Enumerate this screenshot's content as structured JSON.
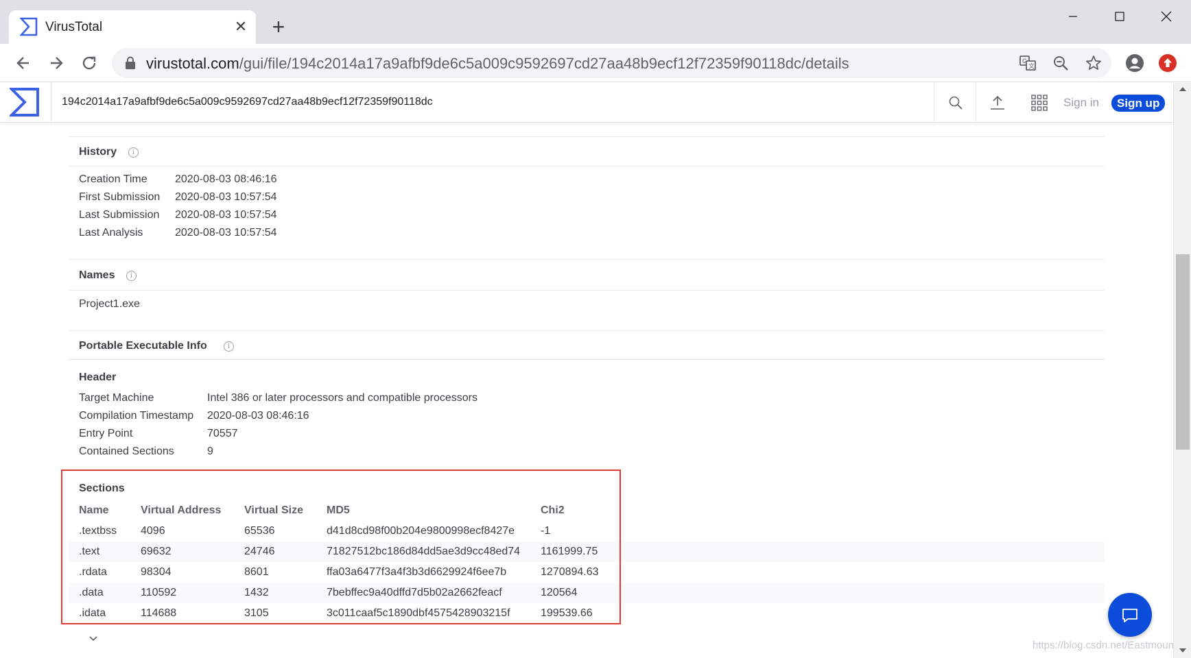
{
  "browser": {
    "tab_title": "VirusTotal",
    "tab_close": "✕",
    "new_tab": "+",
    "url_host": "virustotal.com",
    "url_path": "/gui/file/194c2014a17a9afbf9de6c5a009c9592697cd27aa48b9ecf12f72359f90118dc/details"
  },
  "header": {
    "search_value": "194c2014a17a9afbf9de6c5a009c9592697cd27aa48b9ecf12f72359f90118dc",
    "sign_in": "Sign in",
    "sign_up": "Sign up"
  },
  "history": {
    "title": "History",
    "rows": [
      {
        "label": "Creation Time",
        "value": "2020-08-03 08:46:16"
      },
      {
        "label": "First Submission",
        "value": "2020-08-03 10:57:54"
      },
      {
        "label": "Last Submission",
        "value": "2020-08-03 10:57:54"
      },
      {
        "label": "Last Analysis",
        "value": "2020-08-03 10:57:54"
      }
    ]
  },
  "names": {
    "title": "Names",
    "items": [
      "Project1.exe"
    ]
  },
  "pe_info": {
    "title": "Portable Executable Info",
    "header_title": "Header",
    "header_rows": [
      {
        "label": "Target Machine",
        "value": "Intel 386 or later processors and compatible processors"
      },
      {
        "label": "Compilation Timestamp",
        "value": "2020-08-03 08:46:16"
      },
      {
        "label": "Entry Point",
        "value": "70557"
      },
      {
        "label": "Contained Sections",
        "value": "9"
      }
    ],
    "sections_title": "Sections",
    "columns": [
      "Name",
      "Virtual Address",
      "Virtual Size",
      "MD5",
      "Chi2"
    ],
    "sections": [
      [
        ".textbss",
        "4096",
        "65536",
        "d41d8cd98f00b204e9800998ecf8427e",
        "-1"
      ],
      [
        ".text",
        "69632",
        "24746",
        "71827512bc186d84dd5ae3d9cc48ed74",
        "1161999.75"
      ],
      [
        ".rdata",
        "98304",
        "8601",
        "ffa03a6477f3a4f3b3d6629924f6ee7b",
        "1270894.63"
      ],
      [
        ".data",
        "110592",
        "1432",
        "7bebffec9a40dffd7d5b02a2662feacf",
        "120564"
      ],
      [
        ".idata",
        "114688",
        "3105",
        "3c011caaf5c1890dbf4575428903215f",
        "199539.66"
      ]
    ]
  },
  "watermark": "https://blog.csdn.net/Eastmount",
  "colors": {
    "brand": "#0b4dda",
    "highlight": "#e53935",
    "update_badge": "#d93025"
  }
}
